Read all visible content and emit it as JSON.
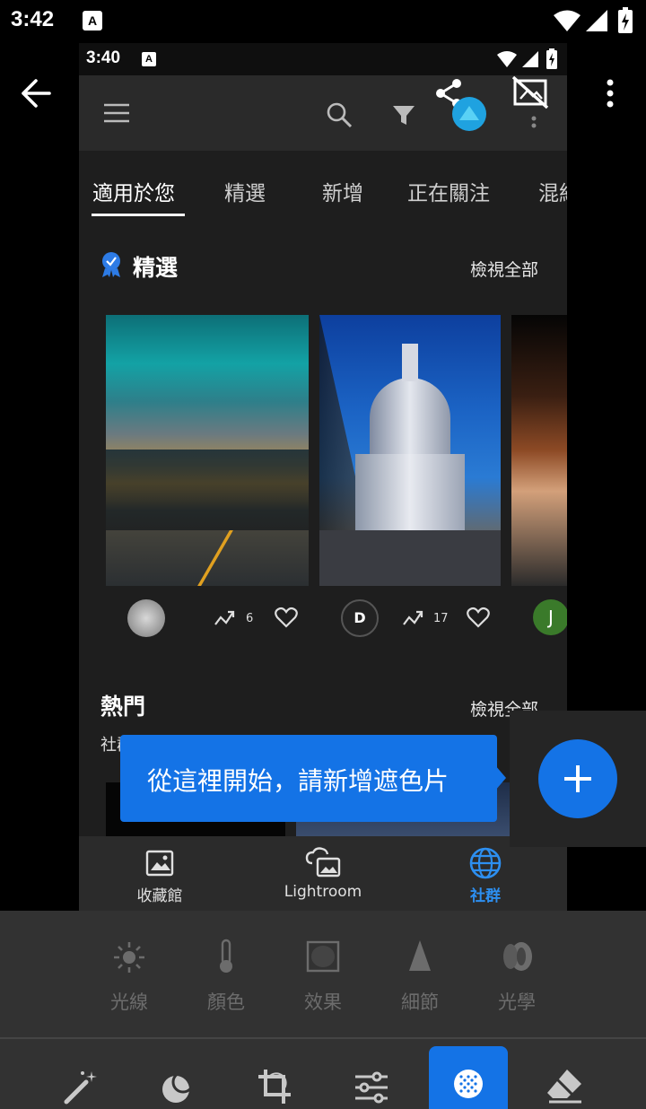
{
  "status_bar": {
    "time": "3:42",
    "a_badge": "A"
  },
  "inner_status_bar": {
    "time": "3:40",
    "a_badge": "A"
  },
  "tabs": [
    "適用於您",
    "精選",
    "新增",
    "正在關注",
    "混組"
  ],
  "featured": {
    "title": "精選",
    "view_all": "檢視全部",
    "cards": [
      {
        "remixes": "6"
      },
      {
        "remixes": "17"
      },
      {
        "avatar_letter": "J"
      }
    ]
  },
  "popular": {
    "title": "熱門",
    "view_all": "檢視全部",
    "subtitle": "社群最熱門內容"
  },
  "bottom_nav": [
    {
      "label": "收藏館",
      "icon": "library-icon"
    },
    {
      "label": "Lightroom",
      "icon": "cloud-photo-icon"
    },
    {
      "label": "社群",
      "icon": "globe-icon"
    }
  ],
  "tooltip": {
    "text": "從這裡開始，請新增遮色片"
  },
  "adjust_tools": [
    {
      "label": "光線",
      "icon": "sun-icon"
    },
    {
      "label": "顏色",
      "icon": "thermometer-icon"
    },
    {
      "label": "效果",
      "icon": "vignette-icon"
    },
    {
      "label": "細節",
      "icon": "triangle-icon"
    },
    {
      "label": "光學",
      "icon": "lens-icon"
    }
  ],
  "main_tools": [
    "magic-wand-icon",
    "healing-icon",
    "crop-icon",
    "sliders-icon",
    "mask-icon",
    "eraser-icon"
  ],
  "colors": {
    "accent": "#1473e6",
    "dim": "#6c6c6c"
  }
}
